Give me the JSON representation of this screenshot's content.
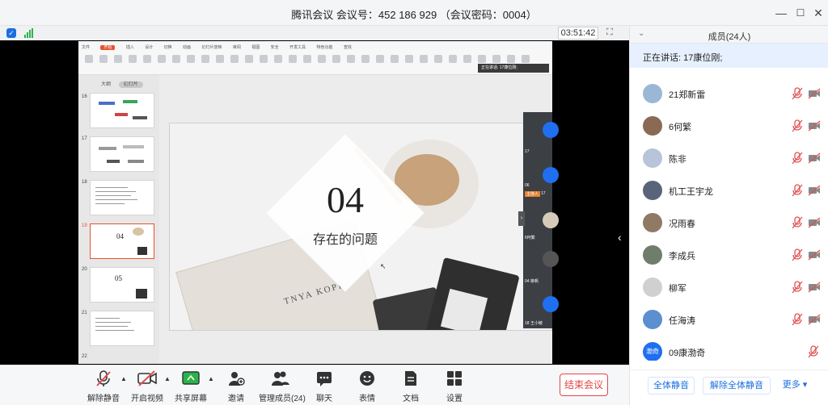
{
  "window": {
    "title": "腾讯会议 会议号：452 186 929 （会议密码：0004）",
    "minimize": "—",
    "maximize": "☐",
    "close": "✕"
  },
  "status": {
    "timer": "03:51:42"
  },
  "shared_screen": {
    "slide": {
      "number": "04",
      "subtitle": "存在的问题",
      "book_text": "TNYA KOPI"
    },
    "thumbnails_tabs": [
      "大纲",
      "幻灯片"
    ],
    "thumbnails": [
      {
        "num": "16"
      },
      {
        "num": "17"
      },
      {
        "num": "18"
      },
      {
        "num": "19",
        "text": "04"
      },
      {
        "num": "20",
        "text": "05"
      },
      {
        "num": "21"
      },
      {
        "num": "22"
      }
    ],
    "ribbon_tabs": [
      "文件",
      "开始",
      "插入",
      "设计",
      "切换",
      "动画",
      "幻灯片放映",
      "审阅",
      "视图",
      "安全",
      "开发工具",
      "特色功能",
      "查找"
    ],
    "speaking_tip": "正在讲话: 17康位刚;",
    "video_tiles": [
      {
        "label": "17"
      },
      {
        "label": "06"
      },
      {
        "tag": "主持人",
        "label": "17"
      },
      {
        "label": "6何繁"
      },
      {
        "label": "04 柳帆"
      },
      {
        "label": "18 王小敏"
      }
    ]
  },
  "toolbar": {
    "unmute": "解除静音",
    "start_video": "开启视频",
    "share_screen": "共享屏幕",
    "invite": "邀请",
    "manage_members": "管理成员(24)",
    "chat": "聊天",
    "reactions": "表情",
    "documents": "文档",
    "settings": "设置",
    "end_meeting": "结束会议"
  },
  "panel": {
    "title": "成员(24人)",
    "speaking": "正在讲话: 17康位刚;",
    "members": [
      {
        "name": "21郑新雷",
        "avatar_color": "#9ab7d6",
        "muted_mic": true,
        "cam_off": true
      },
      {
        "name": "6何繁",
        "avatar_color": "#8a6a55",
        "muted_mic": true,
        "cam_off": true
      },
      {
        "name": "陈非",
        "avatar_color": "#b8c4d8",
        "muted_mic": true,
        "cam_off": true
      },
      {
        "name": "机工王宇龙",
        "avatar_color": "#5a6478",
        "muted_mic": true,
        "cam_off": true
      },
      {
        "name": "况雨春",
        "avatar_color": "#8f7a66",
        "muted_mic": true,
        "cam_off": true
      },
      {
        "name": "李成兵",
        "avatar_color": "#6f7e6a",
        "muted_mic": true,
        "cam_off": true
      },
      {
        "name": "柳军",
        "avatar_color": "#d0d0d0",
        "muted_mic": true,
        "cam_off": true
      },
      {
        "name": "任海涛",
        "avatar_color": "#5b8fd0",
        "muted_mic": true,
        "cam_off": true
      },
      {
        "name": "09康渤奇",
        "avatar_text": "渤奇",
        "avatar_color": "#1f6ff0",
        "muted_mic": true,
        "cam_off": false
      }
    ],
    "mute_all": "全体静音",
    "unmute_all": "解除全体静音",
    "more": "更多 ▾"
  },
  "colors": {
    "accent": "#1f6ff0",
    "danger": "#e54545",
    "mute_red": "#e05050"
  }
}
